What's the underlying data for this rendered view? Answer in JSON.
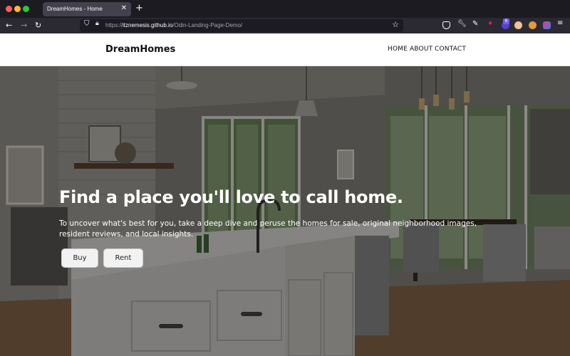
{
  "browser": {
    "tab_title": "DreamHomes - Home",
    "tab_close": "✕",
    "new_tab": "+",
    "url_prefix": "https://",
    "url_host": "itznemesis.github.io",
    "url_path": "/Odin-Landing-Page-Demo/",
    "extension_badge": "6"
  },
  "site": {
    "brand": "DreamHomes",
    "nav": [
      "HOME",
      "ABOUT",
      "CONTACT"
    ]
  },
  "hero": {
    "title": "Find a place you'll love to call home.",
    "subtitle": "To uncover what's best for you, take a deep dive and peruse the homes for sale, original neighborhood images, resident reviews, and local insights.",
    "buttons": {
      "buy": "Buy",
      "rent": "Rent"
    }
  },
  "colors": {
    "browser_bg": "#1c1b22",
    "toolbar_bg": "#2b2a33",
    "hero_overlay": "rgba(0,0,0,0.42)"
  },
  "icons": [
    "back-icon",
    "forward-icon",
    "reload-icon",
    "shield-icon",
    "lock-icon",
    "star-icon",
    "pocket-icon",
    "wrench-icon",
    "pen-icon",
    "extension-icon",
    "menu-icon"
  ]
}
